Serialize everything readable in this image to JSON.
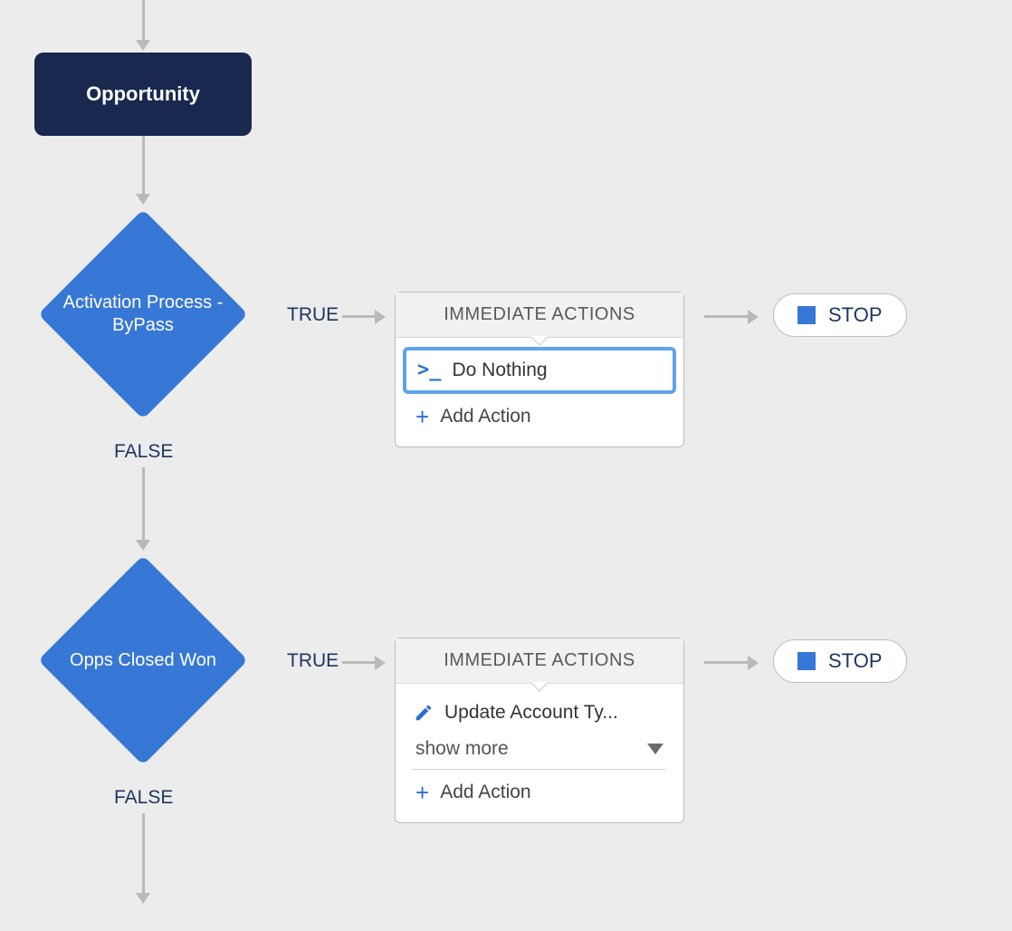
{
  "object_node": {
    "label": "Opportunity"
  },
  "decisions": [
    {
      "label": "Activation Process - ByPass",
      "true_label": "TRUE",
      "false_label": "FALSE",
      "actions": {
        "header": "IMMEDIATE ACTIONS",
        "items": [
          {
            "icon": "apex",
            "label": "Do Nothing",
            "selected": true
          }
        ],
        "add_label": "Add Action"
      },
      "stop": "STOP"
    },
    {
      "label": "Opps Closed Won",
      "true_label": "TRUE",
      "false_label": "FALSE",
      "actions": {
        "header": "IMMEDIATE ACTIONS",
        "items": [
          {
            "icon": "edit",
            "label": "Update Account Ty...",
            "selected": false
          }
        ],
        "show_more": "show more",
        "add_label": "Add Action"
      },
      "stop": "STOP"
    }
  ]
}
